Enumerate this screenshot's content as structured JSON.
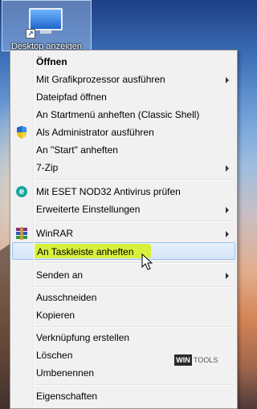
{
  "desktop": {
    "icon_label": "Desktop anzeigen",
    "icon": "desktop-monitor-icon"
  },
  "menu": {
    "items": [
      {
        "label": "Öffnen",
        "bold": true
      },
      {
        "label": "Mit Grafikprozessor ausführen",
        "submenu": true
      },
      {
        "label": "Dateipfad öffnen"
      },
      {
        "label": "An Startmenü anheften (Classic Shell)"
      },
      {
        "label": "Als Administrator ausführen",
        "icon": "uac-shield-icon"
      },
      {
        "label": "An \"Start\" anheften"
      },
      {
        "label": "7-Zip",
        "submenu": true
      },
      {
        "label": "Mit ESET NOD32 Antivirus prüfen",
        "icon": "eset-icon"
      },
      {
        "label": "Erweiterte Einstellungen",
        "submenu": true
      },
      {
        "label": "WinRAR",
        "icon": "winrar-icon",
        "submenu": true
      },
      {
        "label": "An Taskleiste anheften",
        "highlighted": true
      },
      {
        "label": "Senden an",
        "submenu": true
      },
      {
        "label": "Ausschneiden"
      },
      {
        "label": "Kopieren"
      },
      {
        "label": "Verknüpfung erstellen"
      },
      {
        "label": "Löschen"
      },
      {
        "label": "Umbenennen"
      },
      {
        "label": "Eigenschaften"
      }
    ]
  },
  "watermark": {
    "box": "WIN",
    "text": "TOOLS"
  },
  "colors": {
    "highlight_marker": "#d8f032",
    "hover_border": "#9cc2ea",
    "menu_bg": "#f1f1f1"
  }
}
